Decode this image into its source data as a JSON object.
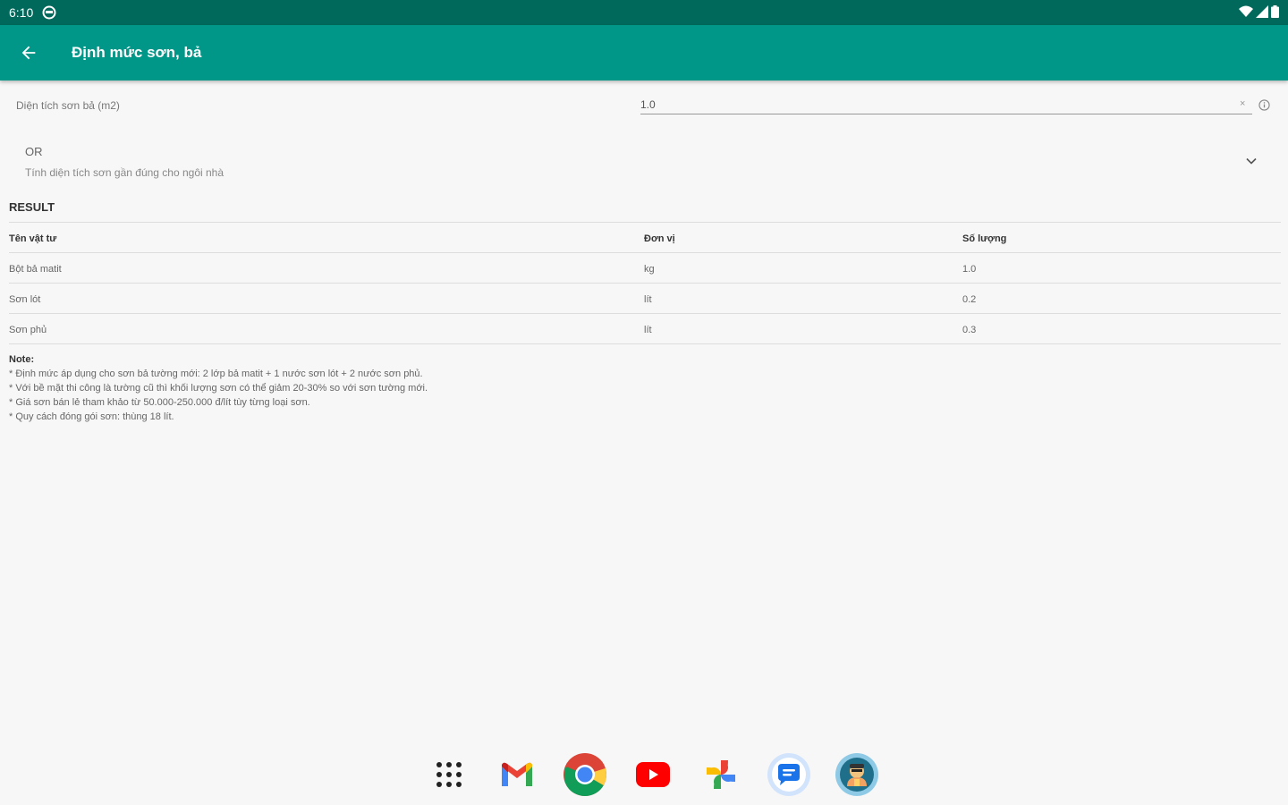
{
  "status_bar": {
    "time": "6:10"
  },
  "app_bar": {
    "title": "Định mức sơn, bả"
  },
  "area": {
    "label": "Diện tích sơn bả (m2)",
    "value": "1.0",
    "clear": "×"
  },
  "expander": {
    "title": "OR",
    "subtitle": "Tính diện tích sơn gần đúng cho ngôi nhà"
  },
  "result": {
    "title": "RESULT",
    "headers": [
      "Tên vật tư",
      "Đơn vị",
      "Số lượng"
    ],
    "rows": [
      [
        "Bột bả matit",
        "kg",
        "1.0"
      ],
      [
        "Sơn lót",
        "lít",
        "0.2"
      ],
      [
        "Sơn phủ",
        "lít",
        "0.3"
      ]
    ]
  },
  "note": {
    "title": "Note:",
    "lines": [
      "* Định mức áp dụng cho sơn bả tường mới: 2 lớp bả matit + 1 nước sơn lót + 2 nước sơn phủ.",
      "* Với bề mặt thi công là tường cũ thì khối lượng sơn có thể giảm 20-30% so với sơn tường mới.",
      "* Giá sơn bán lẻ tham khảo từ 50.000-250.000 đ/lít tùy từng loại sơn.",
      "* Quy cách đóng gói sơn: thùng 18 lít."
    ]
  },
  "dock": {
    "apps": [
      "app-drawer-icon",
      "gmail-icon",
      "chrome-icon",
      "youtube-icon",
      "photos-icon",
      "messages-icon",
      "app-icon"
    ]
  },
  "colors": {
    "status_bar": "#00695c",
    "app_bar": "#009688",
    "background": "#f7f7f7"
  }
}
